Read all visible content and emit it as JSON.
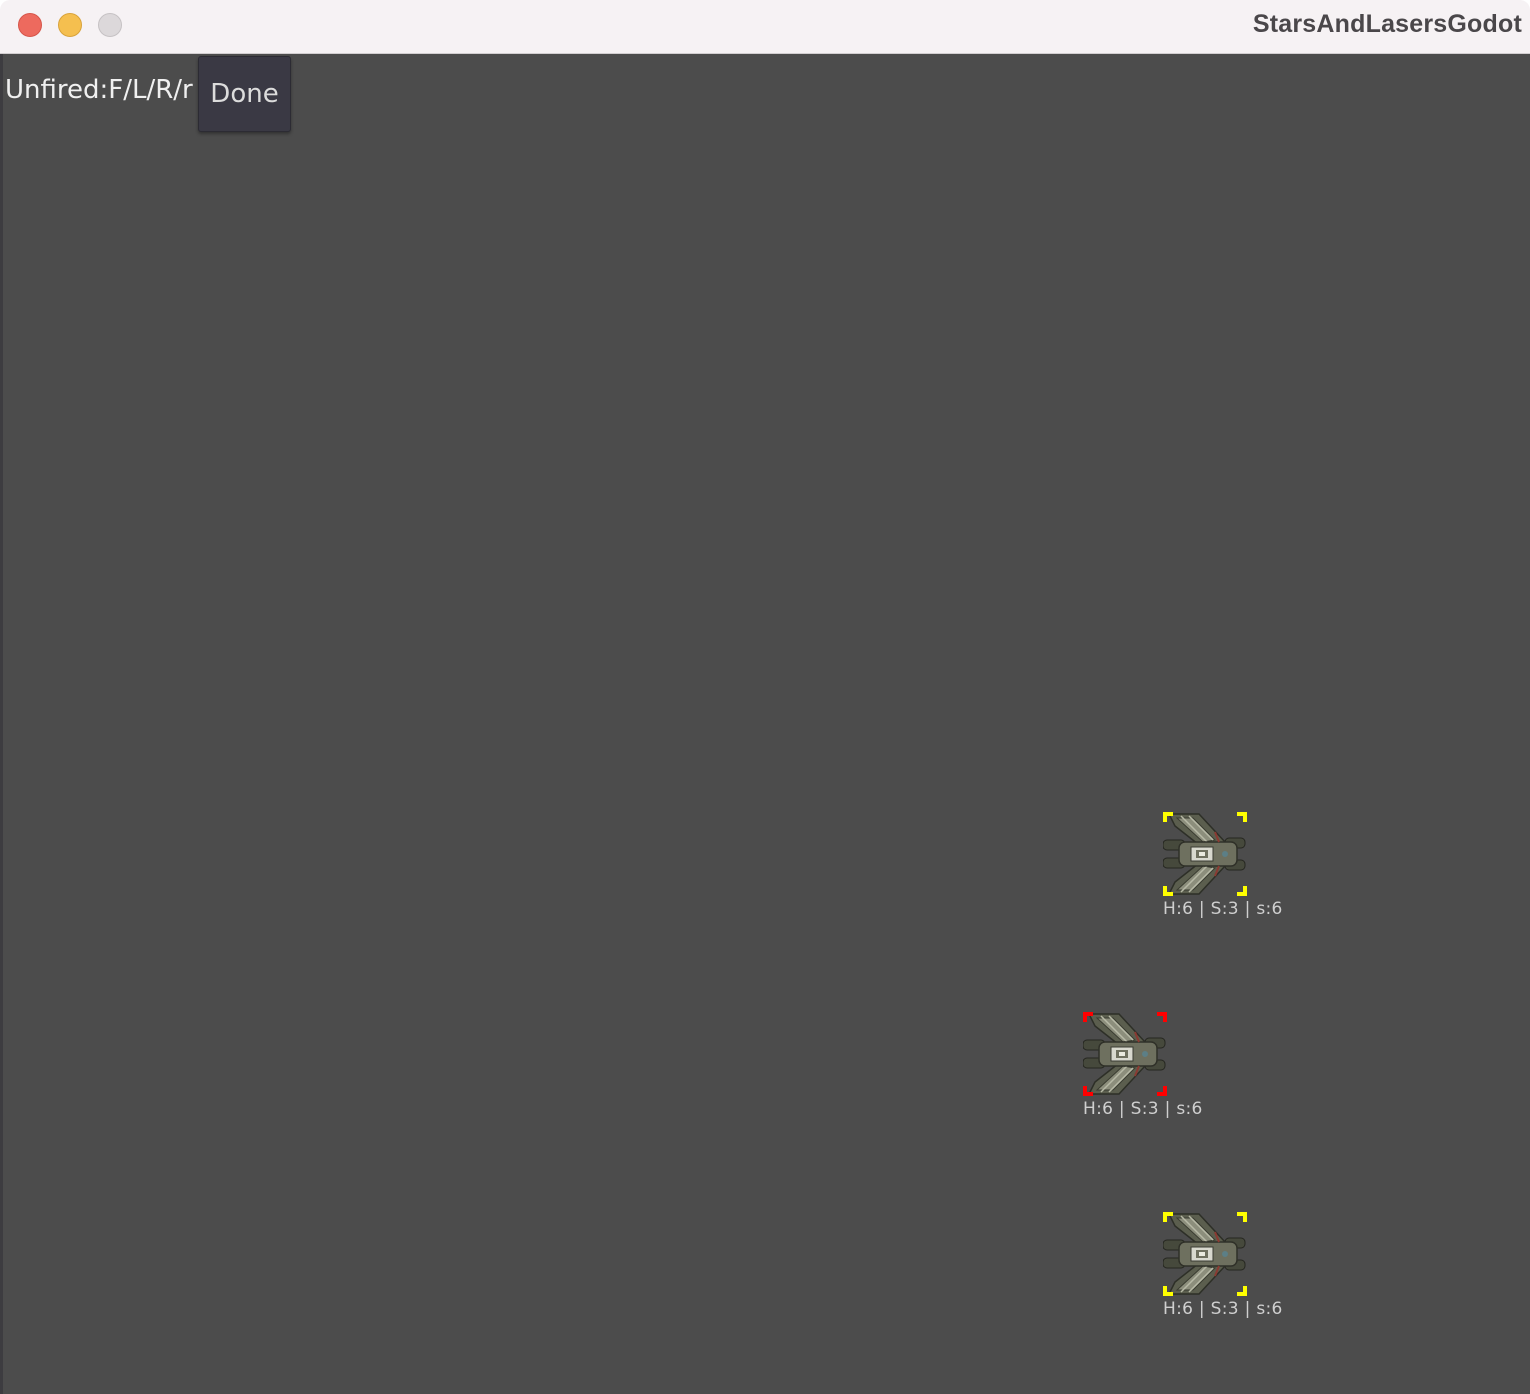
{
  "window": {
    "title": "StarsAndLasersGodot",
    "buttons": [
      {
        "name": "close",
        "color": "#ed6a5e"
      },
      {
        "name": "minimize",
        "color": "#f5bf4f"
      },
      {
        "name": "zoom",
        "color": "#dcd8da"
      }
    ]
  },
  "hud": {
    "unfired_label": "Unfired:F/L/R/r",
    "done_label": "Done"
  },
  "ships": [
    {
      "id": "ship-1",
      "selection_color": "#ffff00",
      "stats": "H:6 | S:3 | s:6"
    },
    {
      "id": "ship-2",
      "selection_color": "#ff0000",
      "stats": "H:6 | S:3 | s:6"
    },
    {
      "id": "ship-3",
      "selection_color": "#ffff00",
      "stats": "H:6 | S:3 | s:6"
    }
  ]
}
